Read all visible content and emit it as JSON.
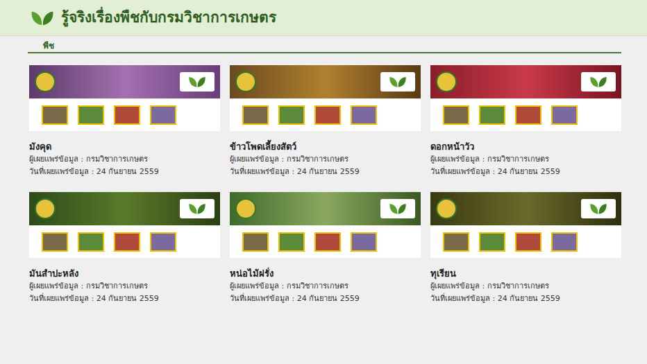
{
  "header": {
    "title": "รู้จริงเรื่องพืชกับกรมวิชาการเกษตร"
  },
  "section": {
    "label": "พืช"
  },
  "cards": [
    {
      "title": "มังคุด",
      "publisher": "ผู้เผยแพร่ข้อมูล : กรมวิชาการเกษตร",
      "date": "วันที่เผยแพร่ข้อมูล : 24 กันยายน 2559"
    },
    {
      "title": "ข้าวโพดเลี้ยงสัตว์",
      "publisher": "ผู้เผยแพร่ข้อมูล : กรมวิชาการเกษตร",
      "date": "วันที่เผยแพร่ข้อมูล : 24 กันยายน 2559"
    },
    {
      "title": "ดอกหน้าวัว",
      "publisher": "ผู้เผยแพร่ข้อมูล : กรมวิชาการเกษตร",
      "date": "วันที่เผยแพร่ข้อมูล : 24 กันยายน 2559"
    },
    {
      "title": "มันสำปะหลัง",
      "publisher": "ผู้เผยแพร่ข้อมูล : กรมวิชาการเกษตร",
      "date": "วันที่เผยแพร่ข้อมูล : 24 กันยายน 2559"
    },
    {
      "title": "หน่อไม้ฝรั่ง",
      "publisher": "ผู้เผยแพร่ข้อมูล : กรมวิชาการเกษตร",
      "date": "วันที่เผยแพร่ข้อมูล : 24 กันยายน 2559"
    },
    {
      "title": "ทุเรียน",
      "publisher": "ผู้เผยแพร่ข้อมูล : กรมวิชาการเกษตร",
      "date": "วันที่เผยแพร่ข้อมูล : 24 กันยายน 2559"
    }
  ]
}
